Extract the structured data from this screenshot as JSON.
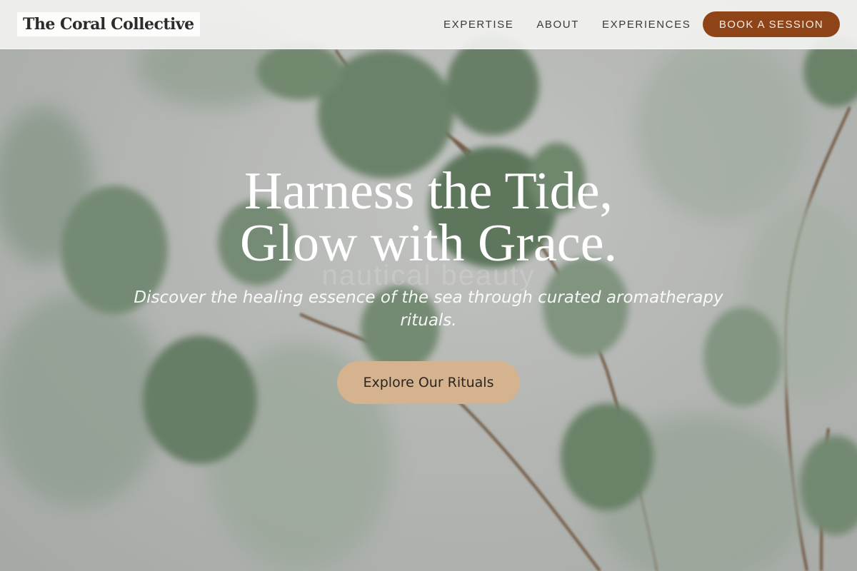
{
  "header": {
    "brand": "The Coral Collective",
    "nav": [
      "EXPERTISE",
      "ABOUT",
      "EXPERIENCES"
    ],
    "book_label": "BOOK A SESSION"
  },
  "hero": {
    "headline_line1": "Harness the Tide,",
    "headline_line2": "Glow with Grace.",
    "watermark": "nautical beauty",
    "subtext": "Discover the healing essence of the sea through curated aromatherapy rituals.",
    "cta_label": "Explore Our Rituals",
    "background_image": "eucalyptus-branches"
  },
  "colors": {
    "book_button": "#8f4418",
    "cta_button": "#d4b38e",
    "header_bg": "#f4f4f2"
  }
}
